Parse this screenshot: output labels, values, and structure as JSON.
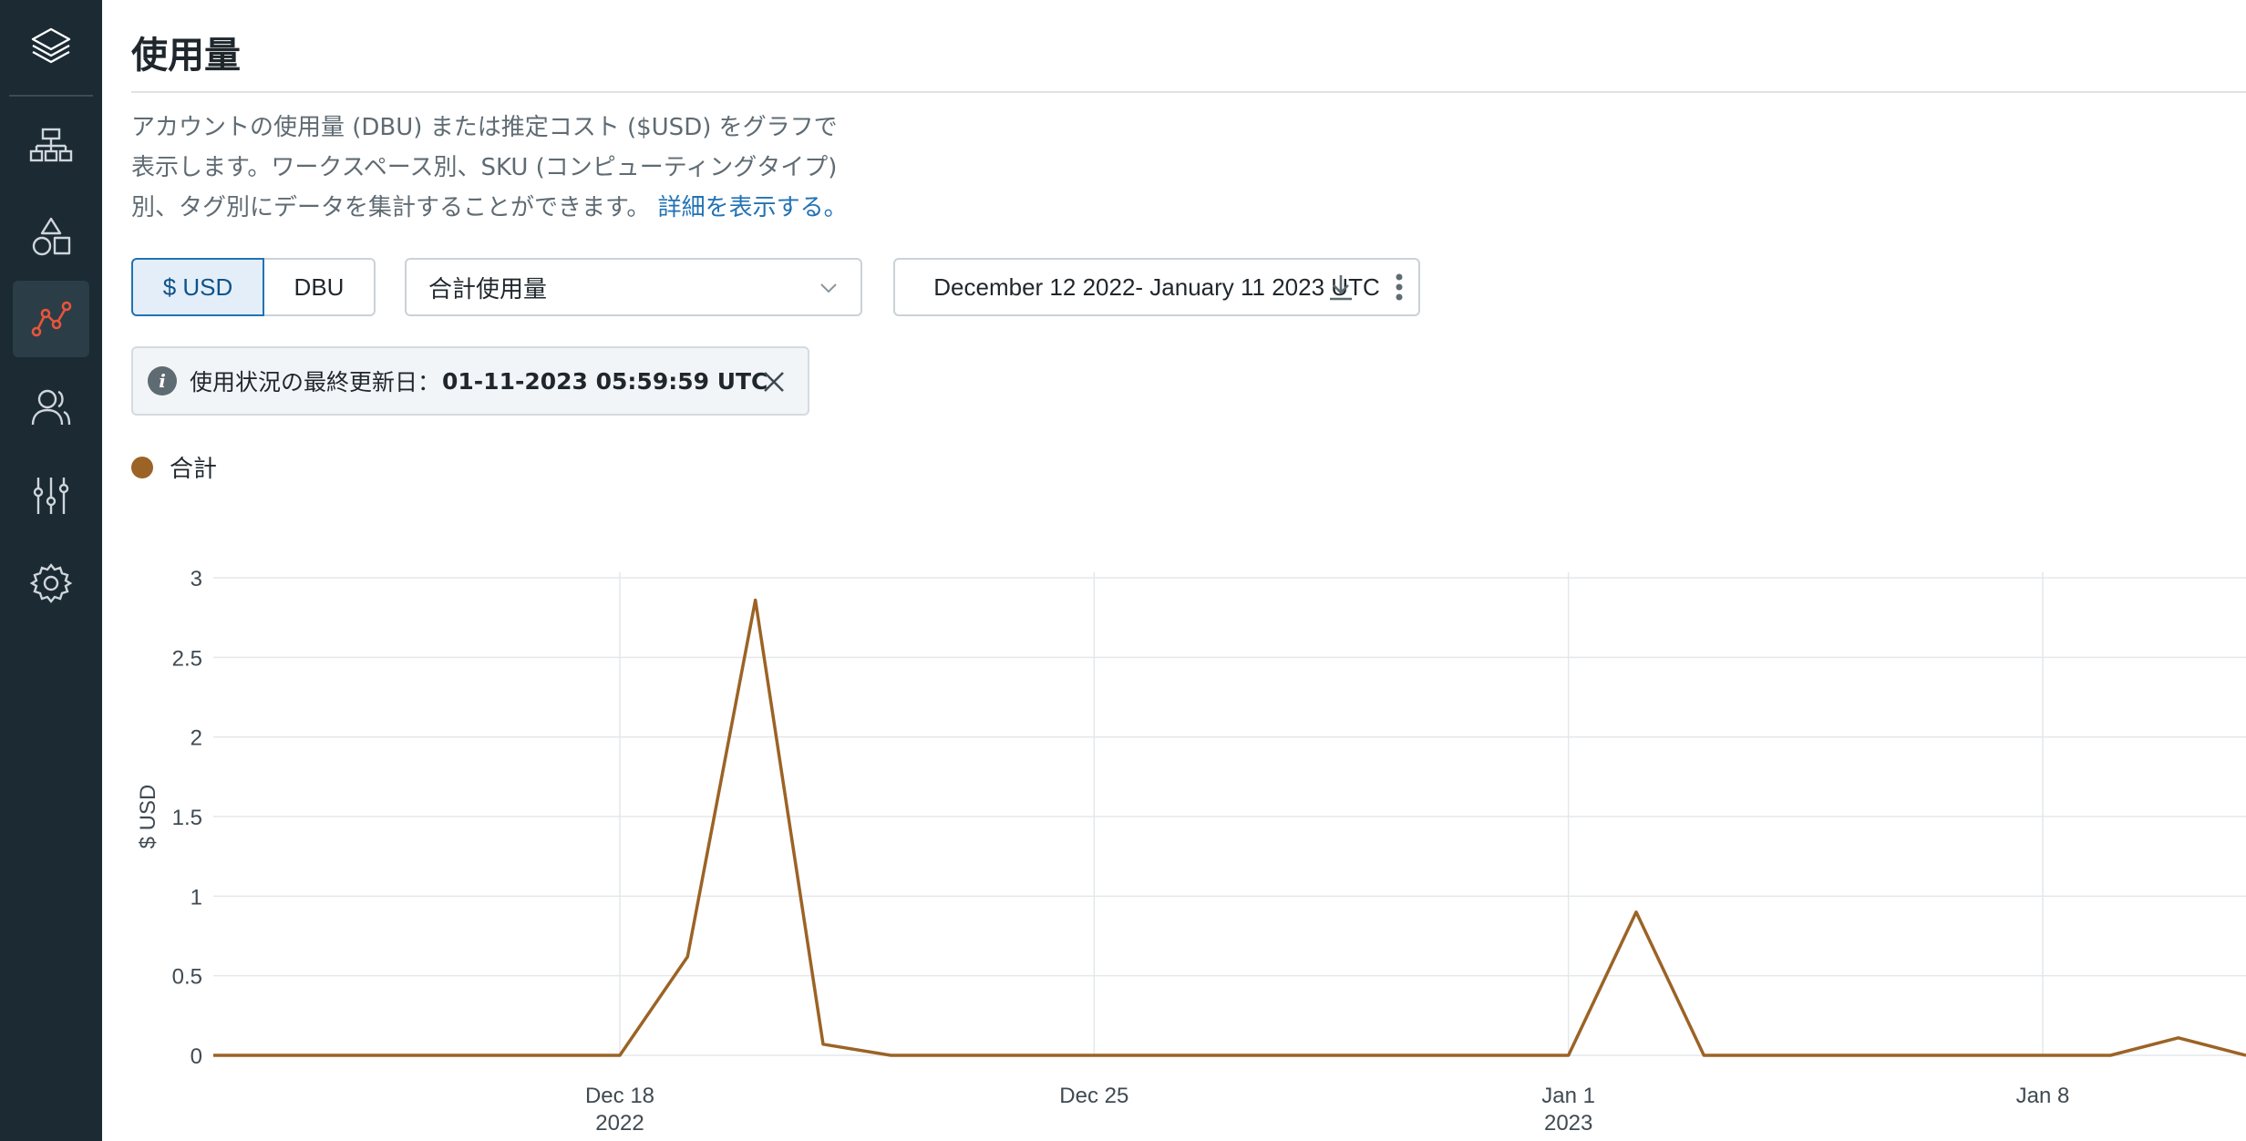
{
  "sidebar": {
    "icons": [
      "layers-icon",
      "workspaces-icon",
      "data-icon",
      "usage-icon",
      "user-icon",
      "settings-sliders-icon",
      "gear-icon"
    ],
    "active": "usage-icon"
  },
  "page": {
    "title": "使用量",
    "description": "アカウントの使用量 (DBU) または推定コスト ($USD) をグラフで表示します。ワークスペース別、SKU (コンピューティングタイプ) 別、タグ別にデータを集計することができます。",
    "description_lines": [
      "アカウントの使用量 (DBU) または推定コスト ($USD) をグラフで",
      "表示します。ワークスペース別、SKU (コンピューティングタイプ)",
      "別、タグ別にデータを集計することができます。"
    ],
    "learn_more": "詳細を表示する。"
  },
  "controls": {
    "unit_usd": "$ USD",
    "unit_dbu": "DBU",
    "unit_selected": "$ USD",
    "aggregation": "合計使用量",
    "date_range": "December 12 2022- January 11 2023 UTC"
  },
  "notice": {
    "label": "使用状況の最終更新日：",
    "timestamp": "01-11-2023 05:59:59 UTC"
  },
  "colors": {
    "accent": "#2272b4",
    "series": "#9b6325",
    "sidebar_bg": "#1b2a33",
    "active_icon": "#e8553a"
  },
  "chart_data": {
    "type": "line",
    "ylabel": "$ USD",
    "xlabel": "",
    "ylim": [
      0,
      3
    ],
    "y_ticks": [
      0,
      0.5,
      1,
      1.5,
      2,
      2.5,
      3
    ],
    "grid": true,
    "legend_position": "top-left",
    "x_ticks": [
      {
        "date": "2022-12-18",
        "label": "Dec 18",
        "sublabel": "2022"
      },
      {
        "date": "2022-12-25",
        "label": "Dec 25",
        "sublabel": ""
      },
      {
        "date": "2023-01-01",
        "label": "Jan 1",
        "sublabel": "2023"
      },
      {
        "date": "2023-01-08",
        "label": "Jan 8",
        "sublabel": ""
      }
    ],
    "series": [
      {
        "name": "合計",
        "color": "#9b6325",
        "x": [
          "2022-12-12",
          "2022-12-13",
          "2022-12-14",
          "2022-12-15",
          "2022-12-16",
          "2022-12-17",
          "2022-12-18",
          "2022-12-19",
          "2022-12-20",
          "2022-12-21",
          "2022-12-22",
          "2022-12-23",
          "2022-12-24",
          "2022-12-25",
          "2022-12-26",
          "2022-12-27",
          "2022-12-28",
          "2022-12-29",
          "2022-12-30",
          "2022-12-31",
          "2023-01-01",
          "2023-01-02",
          "2023-01-03",
          "2023-01-04",
          "2023-01-05",
          "2023-01-06",
          "2023-01-07",
          "2023-01-08",
          "2023-01-09",
          "2023-01-10",
          "2023-01-11"
        ],
        "values": [
          0,
          0,
          0,
          0,
          0,
          0,
          0,
          0.62,
          2.86,
          0.07,
          0,
          0,
          0,
          0,
          0,
          0,
          0,
          0,
          0,
          0,
          0,
          0.9,
          0,
          0,
          0,
          0,
          0,
          0,
          0,
          0.11,
          0
        ]
      }
    ]
  }
}
